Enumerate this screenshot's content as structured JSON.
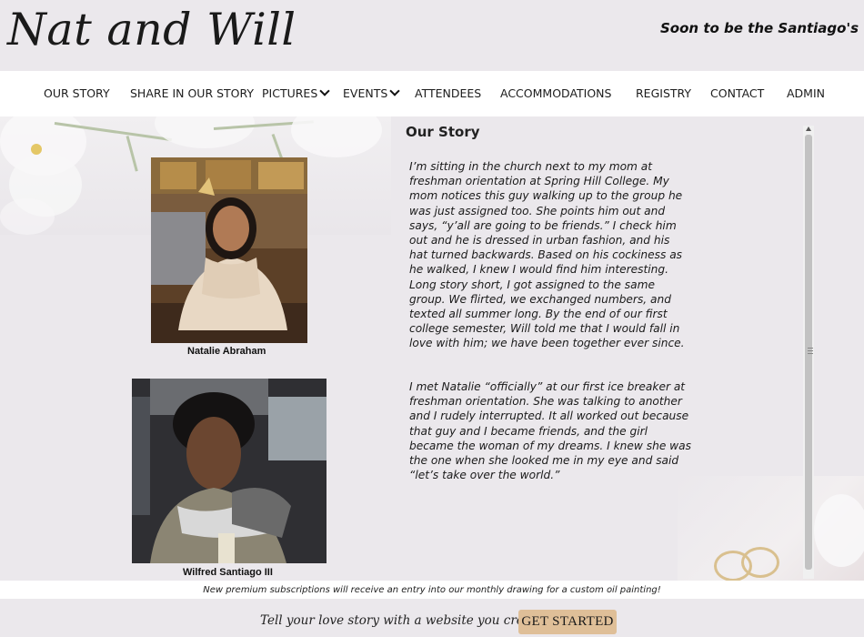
{
  "header": {
    "site_title": "Nat and Will",
    "tagline": "Soon to be the Santiago's"
  },
  "nav": {
    "items": [
      {
        "label": "OUR STORY"
      },
      {
        "label": "SHARE IN OUR STORY"
      },
      {
        "label": "PICTURES",
        "dropdown": true
      },
      {
        "label": "EVENTS",
        "dropdown": true
      },
      {
        "label": "ATTENDEES"
      },
      {
        "label": "ACCOMMODATIONS"
      },
      {
        "label": "REGISTRY"
      },
      {
        "label": "CONTACT"
      },
      {
        "label": "ADMIN"
      }
    ]
  },
  "story": {
    "title": "Our Story",
    "paragraph_1": "I’m sitting in the church next to my mom at freshman orientation at Spring Hill College.  My mom notices this guy walking up to the group he was just assigned too.  She points him out and says, “y’all are going to be friends.”  I check him out and he is dressed in urban fashion, and his hat turned backwards.  Based on his cockiness as he walked, I knew I would find him interesting.  Long story short, I got assigned to the same group.  We flirted, we exchanged numbers, and texted all summer long.  By the end of our first college semester, Will told me that I would fall in love with him; we have been together ever since.",
    "paragraph_2": "I met Natalie “officially” at our first ice breaker at freshman orientation.  She was talking to another and I rudely interrupted.  It all worked out because that guy and I became friends, and the girl became the woman of my dreams.  I knew she was the one when she looked me in my eye and said “let’s take over the world.”"
  },
  "photos": {
    "bride_caption": "Natalie  Abraham",
    "groom_caption": "Wilfred Santiago III"
  },
  "promo": {
    "text": "New premium subscriptions will receive an entry into our monthly drawing for a custom oil painting!"
  },
  "footer": {
    "text": "Tell your love story with a website you create!",
    "button_label": "GET STARTED"
  },
  "colors": {
    "background": "#ebe8ec",
    "nav_background": "#ffffff",
    "button_background": "#dfbf98",
    "text": "#1a1a1a"
  },
  "icons": [
    "chevron-down-icon",
    "scroll-up-icon"
  ]
}
